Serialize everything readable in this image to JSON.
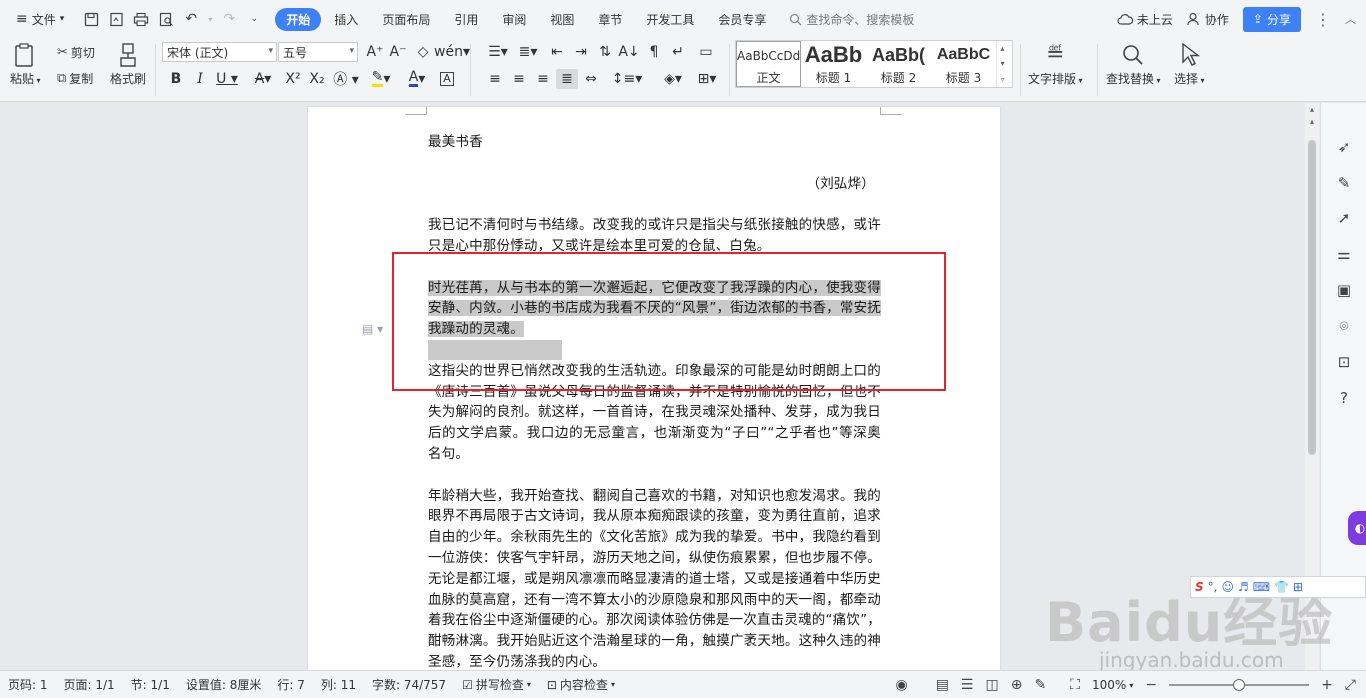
{
  "menubar": {
    "file_label": "文件",
    "tabs": [
      {
        "label": "开始",
        "active": true
      },
      {
        "label": "插入"
      },
      {
        "label": "页面布局"
      },
      {
        "label": "引用"
      },
      {
        "label": "审阅"
      },
      {
        "label": "视图"
      },
      {
        "label": "章节"
      },
      {
        "label": "开发工具"
      },
      {
        "label": "会员专享"
      }
    ],
    "search_placeholder": "查找命令、搜索模板",
    "cloud_label": "未上云",
    "collab_label": "协作",
    "share_label": "分享"
  },
  "ribbon": {
    "paste": "粘贴",
    "cut": "剪切",
    "copy": "复制",
    "format_painter": "格式刷",
    "font_name": "宋体 (正文)",
    "font_size": "五号",
    "styles": [
      {
        "preview": "AaBbCcDd",
        "name": "正文"
      },
      {
        "preview": "AaBb",
        "name": "标题 1"
      },
      {
        "preview": "AaBb(",
        "name": "标题 2"
      },
      {
        "preview": "AaBbC",
        "name": "标题 3"
      }
    ],
    "text_layout": "文字排版",
    "find_replace": "查找替换",
    "select": "选择"
  },
  "document": {
    "title": "最美书香",
    "author": "（刘弘烨）",
    "p1": "我已记不清何时与书结缘。改变我的或许只是指尖与纸张接触的快感，或许只是心中那份悸动，又或许是绘本里可爱的仓鼠、白兔。",
    "p2": "时光荏苒，从与书本的第一次邂逅起，它便改变了我浮躁的内心，使我变得安静、内敛。小巷的书店成为我看不厌的“风景”，街边浓郁的书香，常安抚我躁动的灵魂。",
    "p3": "这指尖的世界已悄然改变我的生活轨迹。印象最深的可能是幼时朗朗上口的《唐诗三百首》虽说父母每日的监督诵读，并不是特别愉悦的回忆，但也不失为解闷的良剂。就这样，一首首诗，在我灵魂深处播种、发芽，成为我日后的文学启蒙。我口边的无忌童言，也渐渐变为“子曰”“之乎者也”等深奥名句。",
    "p4": "年龄稍大些，我开始查找、翻阅自己喜欢的书籍，对知识也愈发渴求。我的眼界不再局限于古文诗词，我从原本痴痴跟读的孩童，变为勇往直前，追求自由的少年。余秋雨先生的《文化苦旅》成为我的挚爱。书中，我隐约看到一位游侠：侠客气宇轩昂，游历天地之间，纵使伤痕累累，但也步履不停。无论是都江堰，或是朔风凛凛而略显凄清的道士塔，又或是接通着中华历史血脉的莫高窟，还有一湾不算太小的沙原隐泉和那风雨中的天一阁，都牵动着我在俗尘中逐渐僵硬的心。那次阅读体验仿佛是一次直击灵魂的“痛饮”，酣畅淋漓。我开始贴近这个浩瀚星球的一角，触摸广袤天地。这种久违的神圣感，至今仍荡涤我的内心。"
  },
  "statusbar": {
    "page_num": "页码: 1",
    "page_count": "页面: 1/1",
    "section": "节: 1/1",
    "setting": "设置值: 8厘米",
    "row": "行: 7",
    "col": "列: 11",
    "word_count": "字数: 74/757",
    "spell_check": "拼写检查",
    "content_check": "内容检查",
    "zoom": "100%",
    "zoom_fraction": 0.5
  },
  "watermark": {
    "brand": "Baidu经验",
    "url": "jingyan.baidu.com"
  },
  "colors": {
    "accent": "#3e80f6",
    "selection": "#c9c9c9",
    "annotation_box": "#e8212a"
  }
}
